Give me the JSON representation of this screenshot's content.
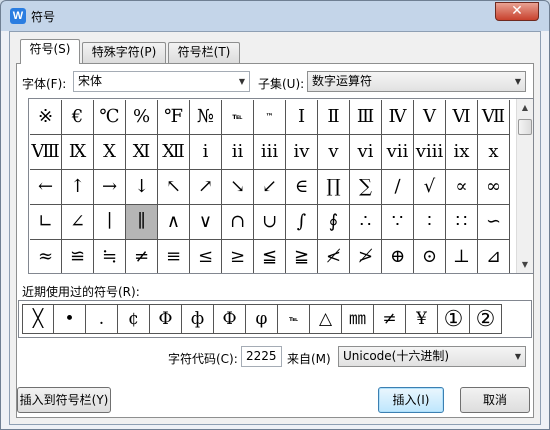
{
  "window": {
    "title": "符号",
    "app_icon": "W",
    "close_label": "✕"
  },
  "tabs": [
    {
      "label": "符号(S)",
      "active": true
    },
    {
      "label": "特殊字符(P)",
      "active": false
    },
    {
      "label": "符号栏(T)",
      "active": false
    }
  ],
  "font": {
    "label": "字体(F):",
    "value": "宋体"
  },
  "subset": {
    "label": "子集(U):",
    "value": "数字运算符"
  },
  "grid": {
    "symbols": [
      "※",
      "€",
      "℃",
      "%",
      "℉",
      "№",
      "℡",
      "™",
      "Ⅰ",
      "Ⅱ",
      "Ⅲ",
      "Ⅳ",
      "Ⅴ",
      "Ⅵ",
      "Ⅶ",
      "Ⅷ",
      "Ⅸ",
      "Ⅹ",
      "Ⅺ",
      "Ⅻ",
      "ⅰ",
      "ⅱ",
      "ⅲ",
      "ⅳ",
      "ⅴ",
      "ⅵ",
      "ⅶ",
      "ⅷ",
      "ⅸ",
      "ⅹ",
      "←",
      "↑",
      "→",
      "↓",
      "↖",
      "↗",
      "↘",
      "↙",
      "∈",
      "∏",
      "∑",
      "∕",
      "√",
      "∝",
      "∞",
      "∟",
      "∠",
      "∣",
      "∥",
      "∧",
      "∨",
      "∩",
      "∪",
      "∫",
      "∮",
      "∴",
      "∵",
      "∶",
      "∷",
      "∽",
      "≈",
      "≌",
      "≒",
      "≠",
      "≡",
      "≤",
      "≥",
      "≦",
      "≧",
      "≮",
      "≯",
      "⊕",
      "⊙",
      "⊥",
      "⊿"
    ],
    "selected_index": 48
  },
  "recent": {
    "label": "近期使用过的符号(R):",
    "symbols": [
      "╳",
      "•",
      "․",
      "¢",
      "Φ",
      "ф",
      "Ф",
      "φ",
      "℡",
      "△",
      "㎜",
      "≠",
      "¥",
      "①",
      "②"
    ]
  },
  "char_code": {
    "label": "字符代码(C):",
    "value": "2225"
  },
  "from": {
    "label": "来自(M)",
    "value": "Unicode(十六进制)"
  },
  "buttons": {
    "insert_to_bar": "插入到符号栏(Y)",
    "insert": "插入(I)",
    "cancel": "取消"
  }
}
